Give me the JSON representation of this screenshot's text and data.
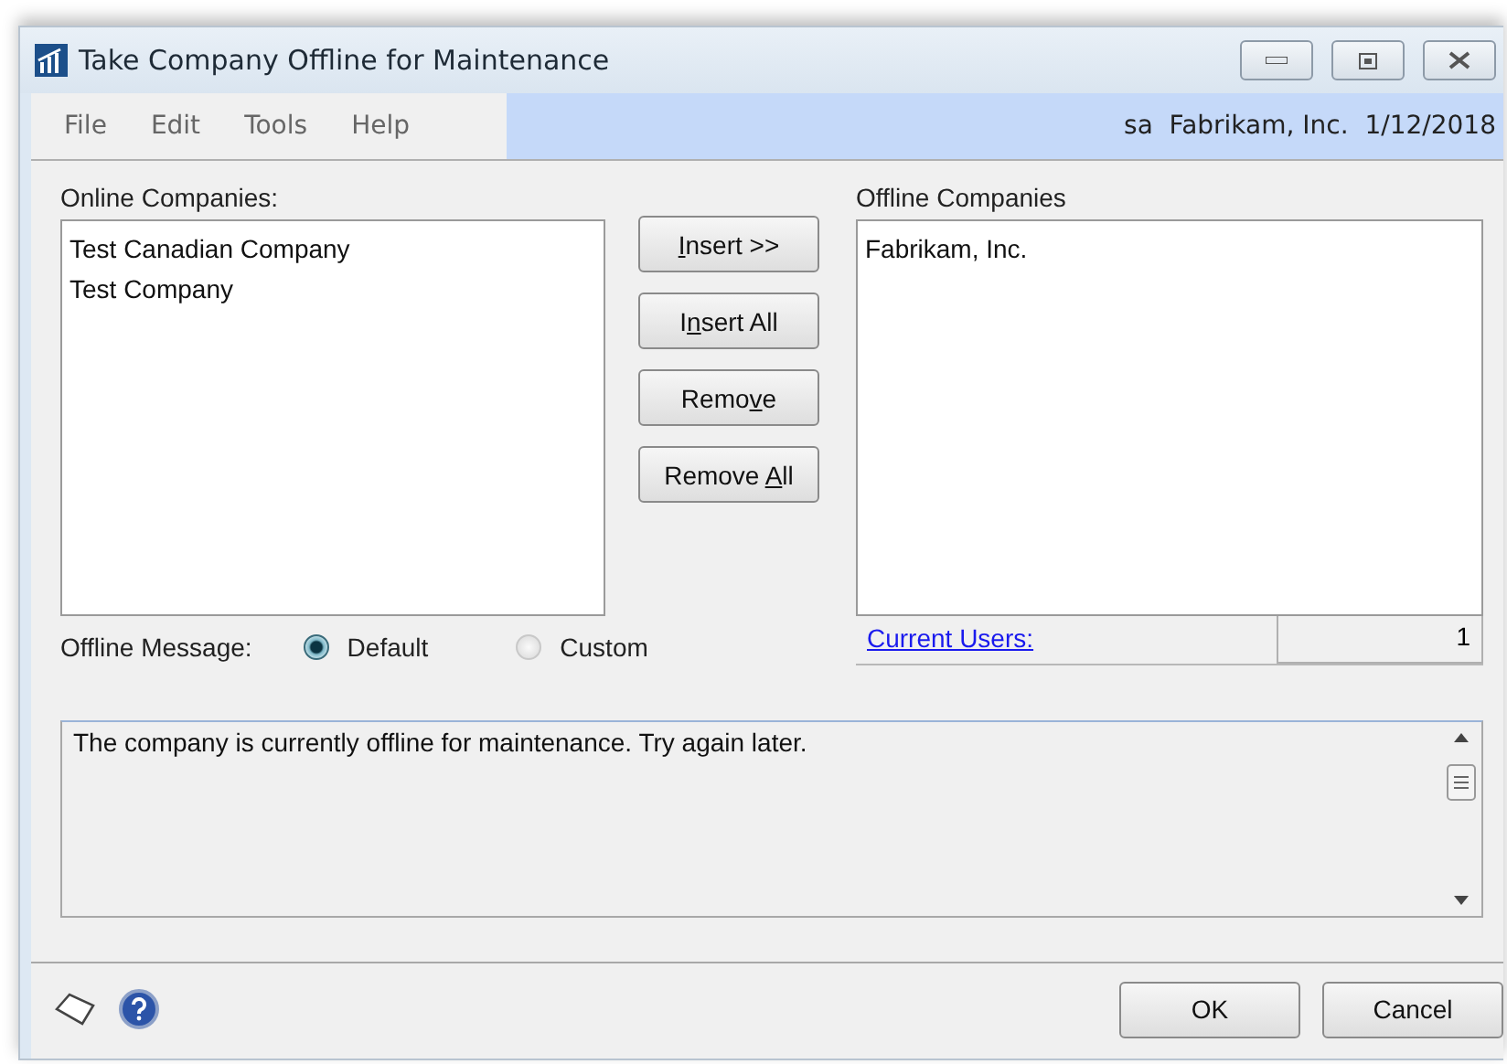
{
  "window": {
    "title": "Take Company Offline for Maintenance"
  },
  "menu": [
    "File",
    "Edit",
    "Tools",
    "Help"
  ],
  "status": {
    "user": "sa",
    "company": "Fabrikam, Inc.",
    "date": "1/12/2018"
  },
  "online": {
    "label": "Online Companies:",
    "items": [
      "Test Canadian Company",
      "Test Company"
    ]
  },
  "actions": [
    {
      "parts": [
        {
          "text": "I",
          "underlined": true
        },
        {
          "text": "nsert >>",
          "underlined": false
        }
      ]
    },
    {
      "parts": [
        {
          "text": "I",
          "underlined": false
        },
        {
          "text": "n",
          "underlined": true
        },
        {
          "text": "sert All",
          "underlined": false
        }
      ]
    },
    {
      "parts": [
        {
          "text": "Remo",
          "underlined": false
        },
        {
          "text": "v",
          "underlined": true
        },
        {
          "text": "e",
          "underlined": false
        }
      ]
    },
    {
      "parts": [
        {
          "text": "Remove ",
          "underlined": false
        },
        {
          "text": "A",
          "underlined": true
        },
        {
          "text": "ll",
          "underlined": false
        }
      ]
    }
  ],
  "offline": {
    "label": "Offline Companies",
    "items": [
      "Fabrikam, Inc."
    ]
  },
  "current_users": {
    "label": "Current Users:",
    "count": "1"
  },
  "offline_message": {
    "label": "Offline Message:",
    "options": [
      {
        "label": "Default",
        "selected": true
      },
      {
        "label": "Custom",
        "selected": false
      }
    ],
    "text": "The company is currently offline for maintenance. Try again later."
  },
  "buttons": [
    "OK",
    "Cancel"
  ]
}
